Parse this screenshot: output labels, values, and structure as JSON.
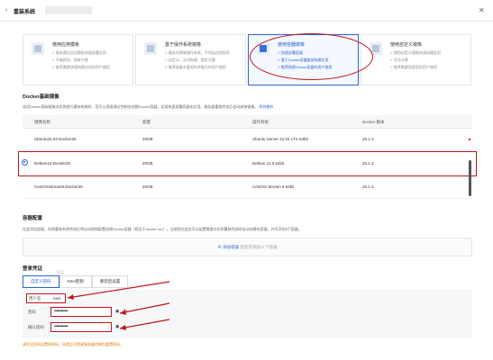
{
  "window": {
    "title": "重装系统",
    "back_icon": "chevron-left-icon",
    "close_icon": "close-icon"
  },
  "cards": [
    {
      "title": "使用应用模板",
      "lines": [
        "服务通过应用模板快速部署应用",
        "开箱即用，简单方便",
        "推荐需要快速构建应用的用户使用"
      ],
      "icon": "template-icon"
    },
    {
      "title": "基于操作系统镜像",
      "lines": [
        "服务内预装操作系统，不包括应用程序",
        "自定义，灵活构建，稳定可靠",
        "推荐具备丰富的技术能力的用户使用"
      ],
      "icon": "os-image-icon"
    },
    {
      "title": "使用容器镜像",
      "lines": [
        "快速部署容器",
        "基于Docker容器服务构建应用",
        "推荐熟悉Docker容器的用户使用"
      ],
      "icon": "container-image-icon",
      "selected": true
    },
    {
      "title": "使用自定义镜像",
      "lines": [
        "使用自定义镜像快速创建应用",
        "灵活方便",
        "推荐需要同类型的用户使用"
      ],
      "icon": "custom-image-icon"
    }
  ],
  "docker_section": {
    "title": "Docker基础镜像",
    "desc": "选用Docker基础镜像对实例进行重装系统时，您可以直接通过控制台创建Docker容器，实现快速部署容器化应用。服务器重装完成后自动安装镜像。",
    "link": "如何操作"
  },
  "table": {
    "headers": [
      "镜像名称",
      "容量",
      "操作系统",
      "Docker 版本"
    ],
    "rows": [
      {
        "name": "Ubuntu22.04-Docker26",
        "size": "20GB",
        "os": "Ubuntu Server 22.04 LTS 64bit",
        "version": "26.1.3"
      },
      {
        "name": "Debian12-Docker26",
        "size": "20GB",
        "os": "Debian 12.0 64bit",
        "version": "26.1.3",
        "selected": true
      },
      {
        "name": "CentOSStream9-Docker26",
        "size": "20GB",
        "os": "CentOS Stream 9 64bit",
        "version": "26.1.3"
      }
    ]
  },
  "container_section": {
    "title": "容器配置",
    "desc": "在此添加容器，实例重装系统完成后将自动按照配置创建Docker容器（相当于docker run），当前您在此处可以配置需要在实例重装完成时自动创建的容器，共可添加5个容器。",
    "add_label": "添加容器",
    "add_hint": "您还可添加 5 个容器"
  },
  "credential_section": {
    "title": "登录凭证",
    "tabs": [
      "自定义密码",
      "SSH密钥",
      "重装后设置"
    ],
    "active_tab": 0,
    "username_label": "用户名",
    "username_value": "root",
    "password_label": "密码",
    "password_value": "••••••••••••",
    "confirm_label": "确认密码",
    "confirm_value": "••••••••••••",
    "warning": "请牢记您所设置的密码，如遗忘可登录服务器控制台重置密码。"
  },
  "colors": {
    "accent": "#2b64d9",
    "annotation": "#c0141b",
    "warning": "#e07b00"
  }
}
